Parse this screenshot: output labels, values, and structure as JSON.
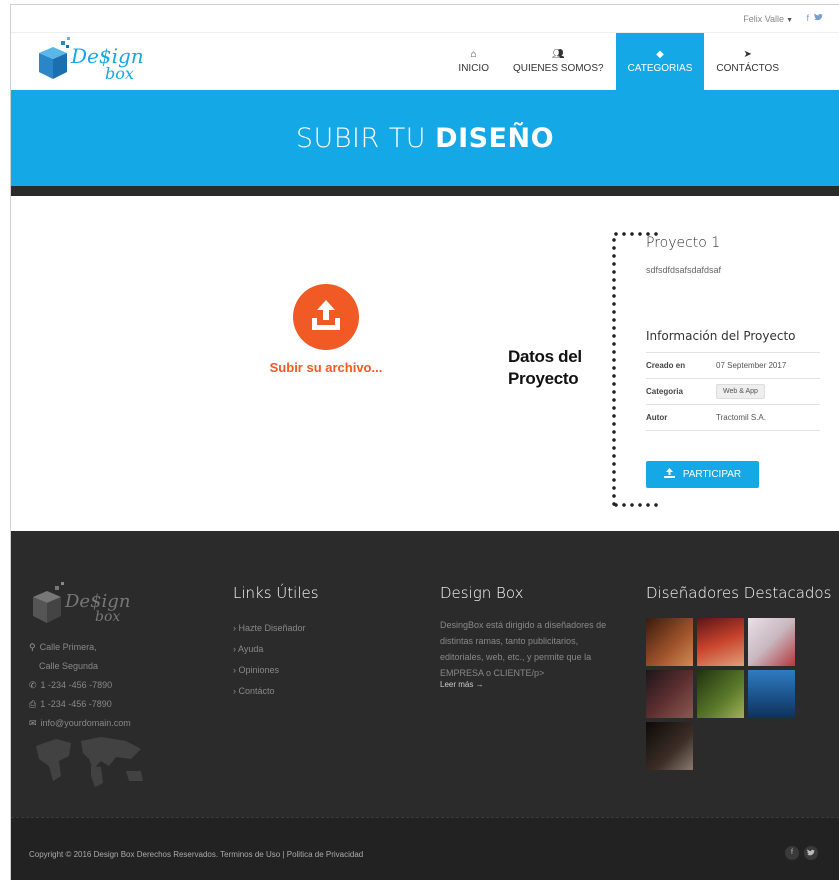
{
  "topbar": {
    "user_name": "Felix Valle",
    "facebook_icon": "f",
    "twitter_icon": "t"
  },
  "logo": {
    "part1": "De$ign",
    "part2": "box"
  },
  "nav": [
    {
      "label": "INICIO",
      "icon": "home-icon"
    },
    {
      "label": "QUIENES SOMOS?",
      "icon": "users-icon"
    },
    {
      "label": "CATEGORIAS",
      "icon": "box-icon"
    },
    {
      "label": "CONTÁCTOS",
      "icon": "send-icon"
    }
  ],
  "hero": {
    "title_light": "SUBIR TU",
    "title_bold": "DISEÑO"
  },
  "upload": {
    "label": "Subir su archivo..."
  },
  "annotation": {
    "line1": "Datos del",
    "line2": "Proyecto"
  },
  "project": {
    "title": "Proyecto 1",
    "description": "sdfsdfdsafsdafdsaf",
    "info_title": "Información del Proyecto",
    "rows": [
      {
        "key": "Creado en",
        "value": "07 September 2017"
      },
      {
        "key": "Categoria",
        "value": "Web & App"
      },
      {
        "key": "Autor",
        "value": "Tractomil S.A."
      }
    ],
    "participate_label": "PARTICIPAR"
  },
  "footer": {
    "logo_part1": "De$ign",
    "logo_part2": "box",
    "contact": {
      "address1": "Calle Primera,",
      "address2": "Calle Segunda",
      "phone": "1 -234 -456 -7890",
      "fax": "1 -234 -456 -7890",
      "email": "info@yourdomain.com"
    },
    "links_title": "Links Útiles",
    "links": [
      "Hazte Diseñador",
      "Ayuda",
      "Opiniones",
      "Contácto"
    ],
    "about_title": "Design Box",
    "about_text": "DesingBox está dirigido a diseñadores de distintas ramas, tanto publicitarios, editoriales, web, etc., y permite que la EMPRESA o CLIENTE/p>",
    "read_more": "Leer más →",
    "featured_title": "Diseñadores Destacados",
    "thumb_colors": [
      "#7a3b22",
      "#b23a2a",
      "#cfc6cc",
      "#4a2a30",
      "#3f5b25",
      "#1d5a8a",
      "#2a2420"
    ]
  },
  "copyright": {
    "text": "Copyright © 2016 Design Box Derechos Reservados. Terminos de Uso | Politica de Privacidad",
    "facebook": "f",
    "twitter": "t"
  },
  "colors": {
    "accent": "#15a8e6",
    "orange": "#f15a24",
    "footer_bg": "#2b2b2b"
  }
}
